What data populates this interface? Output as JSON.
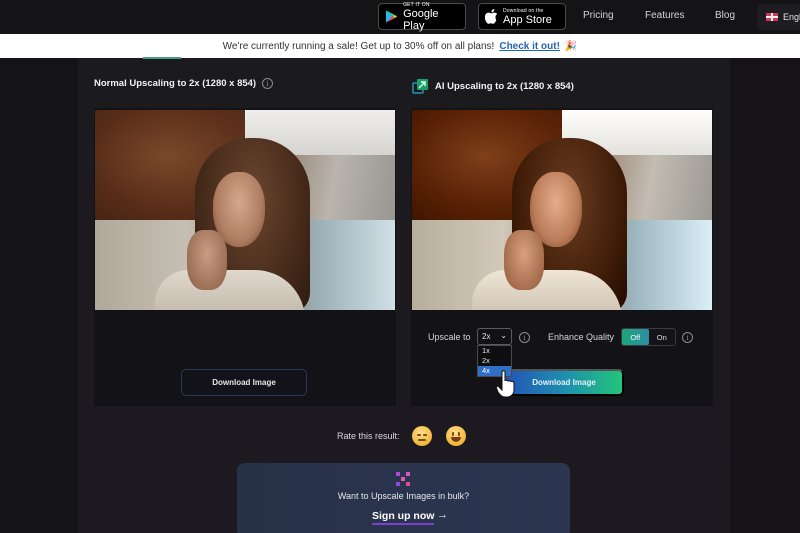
{
  "nav": {
    "google_play": {
      "small": "GET IT ON",
      "big": "Google Play"
    },
    "app_store": {
      "small": "Download on the",
      "big": "App Store"
    },
    "links": [
      "Pricing",
      "Features",
      "Blog"
    ],
    "language": "Engli"
  },
  "banner": {
    "text": "We're currently running a sale! Get up to 30% off on all plans!",
    "link": "Check it out!",
    "emoji": "🎉"
  },
  "left": {
    "title": "Normal Upscaling to 2x (1280 x 854)",
    "download": "Download Image"
  },
  "right": {
    "title": "AI Upscaling to 2x (1280 x 854)",
    "upscale_label": "Upscale to",
    "upscale_value": "2x",
    "upscale_options": [
      "1x",
      "2x",
      "4x"
    ],
    "upscale_highlighted": "4x",
    "enhance_label": "Enhance Quality",
    "enhance_options": [
      "Off",
      "On"
    ],
    "enhance_value": "Off",
    "download": "Download Image"
  },
  "rating": {
    "label": "Rate this result:",
    "options": [
      "sad-face",
      "happy-face"
    ]
  },
  "bulk": {
    "question": "Want to Upscale Images in bulk?",
    "cta": "Sign up now",
    "arrow": "→"
  },
  "colors": {
    "accent_green": "#22c47a",
    "accent_blue": "#2354b6",
    "link_blue": "#2563b5",
    "cta_underline": "#7b3fd1"
  }
}
